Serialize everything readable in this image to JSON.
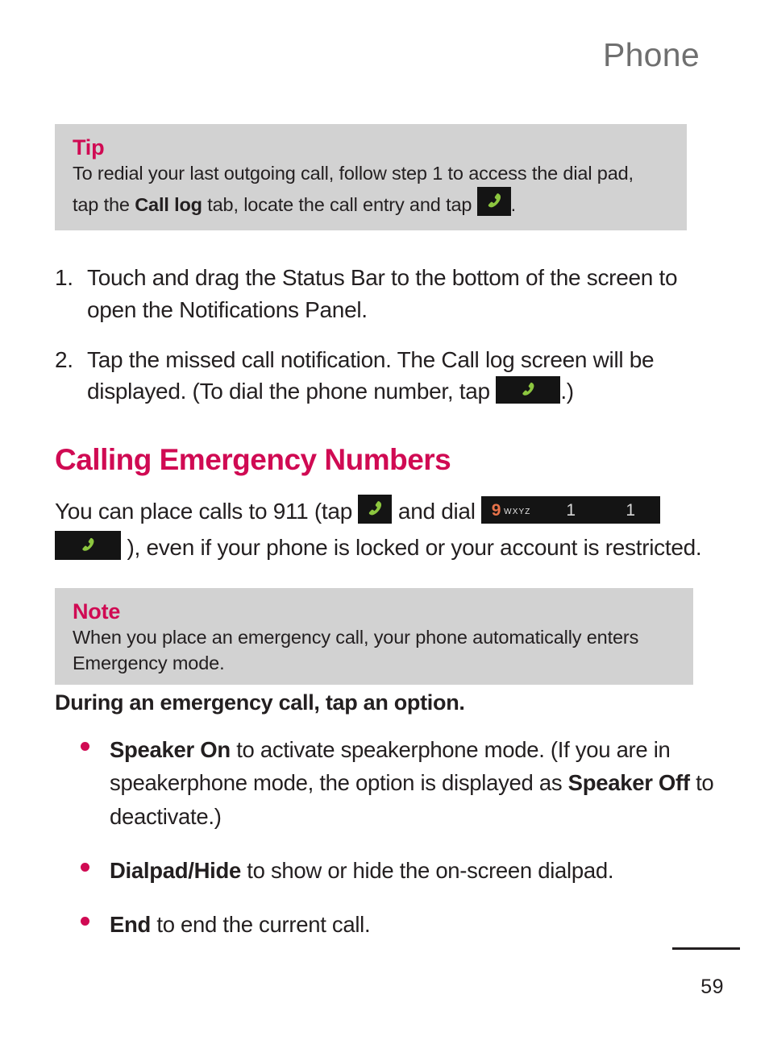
{
  "document": {
    "running_head": "Phone",
    "page_number": "59"
  },
  "tip": {
    "title": "Tip",
    "line1_a": "To redial your last outgoing call, follow step 1 to access the dial pad,",
    "line2_a": "tap the ",
    "line2_bold": "Call log",
    "line2_b": " tab, locate the call entry and tap ",
    "line2_c": "."
  },
  "steps": [
    {
      "number": "1.",
      "text": "Touch and drag the Status Bar to the bottom of the screen to open the Notifications Panel."
    },
    {
      "number": "2.",
      "text_a": "Tap the missed call notification. The Call log screen will be displayed. (To dial the phone number, tap ",
      "text_b": ".)"
    }
  ],
  "section": {
    "heading": "Calling Emergency Numbers",
    "para_a": "You can place calls to 911  (tap ",
    "para_b": " and dial ",
    "para_c": " ), even if your phone is locked or your account is restricted."
  },
  "note": {
    "title": "Note",
    "body": "When you place an emergency call, your phone automatically enters Emergency mode."
  },
  "during_call": {
    "lead_in": "During an emergency call, tap an option.",
    "options": [
      {
        "bold_a": "Speaker On",
        "text_a": " to activate speakerphone mode. (If you are in speakerphone mode, the option is displayed as ",
        "bold_b": "Speaker Off",
        "text_b": " to deactivate.)"
      },
      {
        "bold_a": "Dialpad/Hide",
        "text_a": " to show or hide the on-screen dialpad.",
        "bold_b": "",
        "text_b": ""
      },
      {
        "bold_a": "End",
        "text_a": " to end the current call.",
        "bold_b": "",
        "text_b": ""
      }
    ]
  },
  "keys": {
    "nine_digit": "9",
    "nine_letters": "WXYZ",
    "one_a": "1",
    "one_b": "1"
  },
  "icons": {
    "call_handset": "phone-handset-icon"
  },
  "colors": {
    "accent_magenta": "#d00a53",
    "callout_bg": "#d2d2d2",
    "handset_green": "#8cc63f",
    "key_bg": "#141414",
    "running_head": "#6f6f6f",
    "body_text": "#231f20"
  }
}
